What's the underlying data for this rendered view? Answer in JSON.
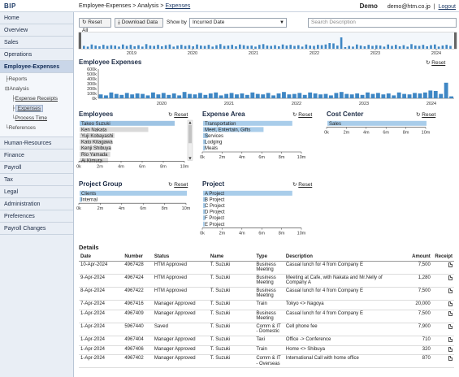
{
  "app": {
    "logo": "BIP"
  },
  "breadcrumb": {
    "part1": "Employee-Expenses",
    "part2": "Analysis",
    "current": "Expenses"
  },
  "user": {
    "env": "Demo",
    "email": "demo@htm.co.jp",
    "logout": "Logout"
  },
  "sidebar": {
    "items_top": [
      "Home",
      "Overview",
      "Sales",
      "Operations",
      "Employee-Expenses"
    ],
    "tree": {
      "reports": "Reports",
      "analysis": "Analysis",
      "expense_receipts": "Expense Receipts",
      "expenses": "Expenses",
      "process_time": "Process Time",
      "references": "References"
    },
    "items_bottom": [
      "Human-Resources",
      "Finance",
      "Payroll",
      "Tax",
      "Legal",
      "Administration",
      "Preferences",
      "Payroll Changes"
    ]
  },
  "toolbar": {
    "reset_all": "Reset All",
    "download": "Download Data",
    "show_by_label": "Show by",
    "show_by_value": "Incurred Date",
    "search_placeholder": "Search Description"
  },
  "icons": {
    "reset": "refresh-icon",
    "download": "download-icon",
    "receipt": "document-icon"
  },
  "colors": {
    "bar": "#3f87c4",
    "bar_light": "#a9cdea",
    "selected_row": "#9ec4e4",
    "muted_row": "#d9d9d9"
  },
  "panels": {
    "employee_expenses": {
      "title": "Employee Expenses",
      "reset": "Reset"
    },
    "employees": {
      "title": "Employees",
      "reset": "Reset"
    },
    "expense_area": {
      "title": "Expense Area",
      "reset": "Reset"
    },
    "cost_center": {
      "title": "Cost Center",
      "reset": "Reset"
    },
    "project_group": {
      "title": "Project Group",
      "reset": "Reset"
    },
    "project": {
      "title": "Project",
      "reset": "Reset"
    }
  },
  "chart_data": [
    {
      "type": "bar",
      "title": "",
      "x_ticks": [
        "2019",
        "2020",
        "2021",
        "2022",
        "2023",
        "2024"
      ],
      "note": "brush / range selector overview"
    },
    {
      "type": "bar",
      "title": "Employee Expenses",
      "y_ticks": [
        "0k",
        "100k",
        "200k",
        "300k",
        "400k",
        "500k",
        "600k"
      ],
      "x_ticks": [
        "2020",
        "2021",
        "2022",
        "2023",
        "2024"
      ],
      "ylim": [
        0,
        600000
      ],
      "values": [
        80000,
        60000,
        120000,
        90000,
        70000,
        110000,
        80000,
        100000,
        90000,
        60000,
        120000,
        80000,
        110000,
        70000,
        100000,
        60000,
        130000,
        90000,
        80000,
        110000,
        70000,
        100000,
        120000,
        60000,
        90000,
        110000,
        80000,
        100000,
        70000,
        120000,
        90000,
        80000,
        110000,
        60000,
        100000,
        130000,
        80000,
        90000,
        110000,
        70000,
        120000,
        100000,
        80000,
        90000,
        60000,
        110000,
        130000,
        90000,
        80000,
        100000,
        70000,
        120000,
        90000,
        110000,
        80000,
        100000,
        60000,
        120000,
        90000,
        80000,
        110000,
        100000,
        120000,
        160000,
        150000,
        90000,
        320000,
        40000
      ]
    },
    {
      "type": "bar",
      "title": "Employees",
      "categories": [
        "Takeo Suzuki",
        "Ken Nakata",
        "Yuji Kobayashi",
        "Kato Kitagawa",
        "Kenji Shibuya",
        "Rio Yamada",
        "Ai Kimura"
      ],
      "values": [
        9000000,
        6500000,
        3300000,
        3100000,
        3000000,
        2900000,
        2700000
      ],
      "x_ticks": [
        "0k",
        "2m",
        "4m",
        "6m",
        "8m",
        "10m"
      ],
      "xlim": [
        0,
        10000000
      ]
    },
    {
      "type": "bar",
      "title": "Expense Area",
      "categories": [
        "Transportation",
        "Meet, Entertain, Gifts",
        "Services",
        "Lodging",
        "Meals"
      ],
      "values": [
        9000000,
        6100000,
        500000,
        300000,
        200000
      ],
      "x_ticks": [
        "0k",
        "2m",
        "4m",
        "6m",
        "8m",
        "10m"
      ],
      "xlim": [
        0,
        10000000
      ]
    },
    {
      "type": "bar",
      "title": "Cost Center",
      "categories": [
        "Sales"
      ],
      "values": [
        10000000
      ],
      "x_ticks": [
        "0k",
        "2m",
        "4m",
        "6m",
        "8m",
        "10m"
      ],
      "xlim": [
        0,
        10000000
      ]
    },
    {
      "type": "bar",
      "title": "Project Group",
      "categories": [
        "Clients",
        "Internal"
      ],
      "values": [
        10000000,
        200000
      ],
      "x_ticks": [
        "0k",
        "2m",
        "4m",
        "6m",
        "8m",
        "10m"
      ],
      "xlim": [
        0,
        10000000
      ]
    },
    {
      "type": "bar",
      "title": "Project",
      "categories": [
        "A Project",
        "B Project",
        "C Project",
        "D Project",
        "F Project",
        "E Project"
      ],
      "values": [
        9000000,
        300000,
        250000,
        220000,
        200000,
        150000
      ],
      "x_ticks": [
        "0k",
        "2m",
        "4m",
        "6m",
        "8m",
        "10m"
      ],
      "xlim": [
        0,
        10000000
      ]
    }
  ],
  "details": {
    "title": "Details",
    "columns": [
      "Date",
      "Number",
      "Status",
      "Name",
      "Type",
      "Description",
      "Amount",
      "Receipt"
    ],
    "rows": [
      [
        "10-Apr-2024",
        "4967428",
        "HTM Approved",
        "T. Suzuki",
        "Business Meeting",
        "Casual lunch for 4 from Company E",
        "7,500"
      ],
      [
        "9-Apr-2024",
        "4967424",
        "HTM Approved",
        "T. Suzuki",
        "Business Meeting",
        "Meeting at Cafe, with Nakata and Mr.Nelly of Company A",
        "1,280"
      ],
      [
        "8-Apr-2024",
        "4967422",
        "HTM Approved",
        "T. Suzuki",
        "Business Meeting",
        "Casual lunch for 4 from Company E",
        "7,500"
      ],
      [
        "7-Apr-2024",
        "4967416",
        "Manager Approved",
        "T. Suzuki",
        "Train",
        "Tokyo <> Nagoya",
        "20,000"
      ],
      [
        "1-Apr-2024",
        "4967409",
        "Manager Approved",
        "T. Suzuki",
        "Business Meeting",
        "Casual lunch for 4 from Company E",
        "7,500"
      ],
      [
        "1-Apr-2024",
        "5967440",
        "Saved",
        "T. Suzuki",
        "Comm & IT - Domestic",
        "Cell phone fee",
        "7,900"
      ],
      [
        "1-Apr-2024",
        "4967404",
        "Manager Approved",
        "T. Suzuki",
        "Taxi",
        "Office -> Conference",
        "710"
      ],
      [
        "1-Apr-2024",
        "4967406",
        "Manager Approved",
        "T. Suzuki",
        "Train",
        "Home <> Shibuya",
        "320"
      ],
      [
        "1-Apr-2024",
        "4967402",
        "Manager Approved",
        "T. Suzuki",
        "Comm & IT - Overseas",
        "International Call with home office",
        "870"
      ]
    ]
  }
}
